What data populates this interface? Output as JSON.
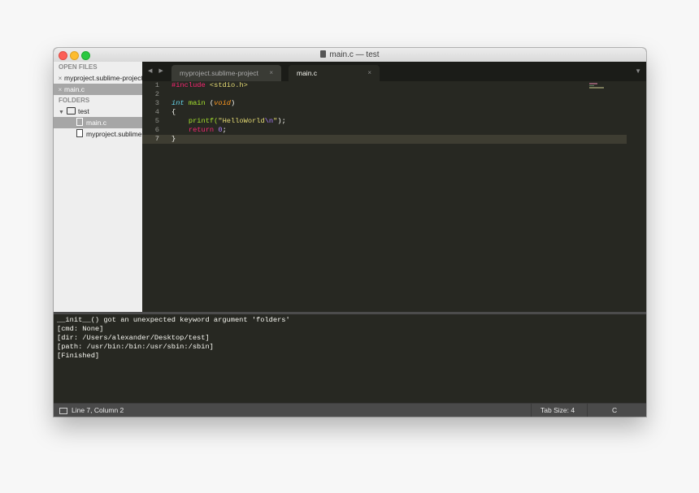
{
  "window": {
    "title": "main.c — test"
  },
  "sidebar": {
    "open_files_header": "OPEN FILES",
    "open_files": [
      {
        "close": "×",
        "label": "myproject.sublime-project"
      },
      {
        "close": "×",
        "label": "main.c"
      }
    ],
    "folders_header": "FOLDERS",
    "folder": {
      "disclosure": "▼",
      "label": "test"
    },
    "folder_files": [
      {
        "label": "main.c"
      },
      {
        "label": "myproject.sublime-project"
      }
    ]
  },
  "tabs": {
    "nav": "◀ ▶",
    "items": [
      {
        "label": "myproject.sublime-project",
        "close": "×"
      },
      {
        "label": "main.c",
        "close": "×"
      }
    ],
    "dropdown": "▼"
  },
  "editor": {
    "line_numbers": [
      "1",
      "2",
      "3",
      "4",
      "5",
      "6",
      "7"
    ],
    "current_line": 7,
    "lines": [
      [
        {
          "t": "#include ",
          "c": "kw"
        },
        {
          "t": "<stdio.h>",
          "c": "st"
        }
      ],
      [],
      [
        {
          "t": "int",
          "c": "ty"
        },
        {
          "t": " "
        },
        {
          "t": "main",
          "c": "fn"
        },
        {
          "t": " ("
        },
        {
          "t": "void",
          "c": "par"
        },
        {
          "t": ")"
        }
      ],
      [
        {
          "t": "{"
        }
      ],
      [
        {
          "t": "    printf(",
          "c": "fn"
        },
        {
          "t": "\"HelloWorld",
          "c": "st"
        },
        {
          "t": "\\n",
          "c": "nm"
        },
        {
          "t": "\"",
          "c": "st"
        },
        {
          "t": ");"
        }
      ],
      [
        {
          "t": "    return ",
          "c": "kw"
        },
        {
          "t": "0",
          "c": "nm"
        },
        {
          "t": ";"
        }
      ],
      [
        {
          "t": "}"
        }
      ]
    ]
  },
  "output": {
    "lines": [
      "__init__() got an unexpected keyword argument 'folders'",
      "[cmd: None]",
      "[dir: /Users/alexander/Desktop/test]",
      "[path: /usr/bin:/bin:/usr/sbin:/sbin]",
      "[Finished]"
    ]
  },
  "status": {
    "position": "Line 7, Column 2",
    "tab_size": "Tab Size: 4",
    "syntax": "C"
  },
  "colors": {
    "editor_bg": "#272822",
    "sidebar_bg": "#eeeeee",
    "keyword": "#f92672",
    "string": "#e6db74",
    "function": "#a6e22e",
    "number": "#ae81ff",
    "type": "#66d9ef"
  }
}
